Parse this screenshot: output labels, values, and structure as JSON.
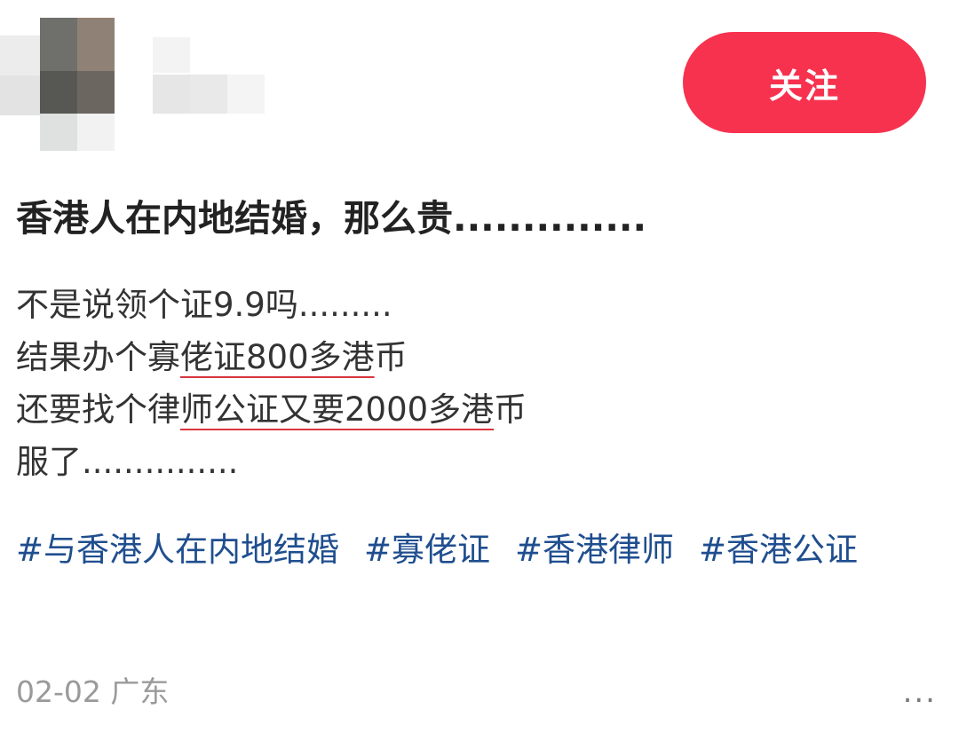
{
  "header": {
    "follow_label": "关注",
    "follow_color": "#f7324f"
  },
  "post": {
    "title": "香港人在内地结婚，那么贵..............",
    "lines": {
      "l1": "不是说领个证9.9吗.........",
      "l2_a": "结果办个寡",
      "l2_b": "佬证800多港",
      "l2_c": "币",
      "l3_a": "还要找个律",
      "l3_b": "师公证又要2000多港",
      "l3_c": "币",
      "l4": "服了..............."
    },
    "tags": [
      "#与香港人在内地结婚",
      "#寡佬证",
      "#香港律师",
      "#香港公证"
    ]
  },
  "footer": {
    "date_location": "02-02 广东",
    "more_label": "..."
  },
  "colors": {
    "tag": "#1f4e8f",
    "underline": "#d9363e"
  }
}
